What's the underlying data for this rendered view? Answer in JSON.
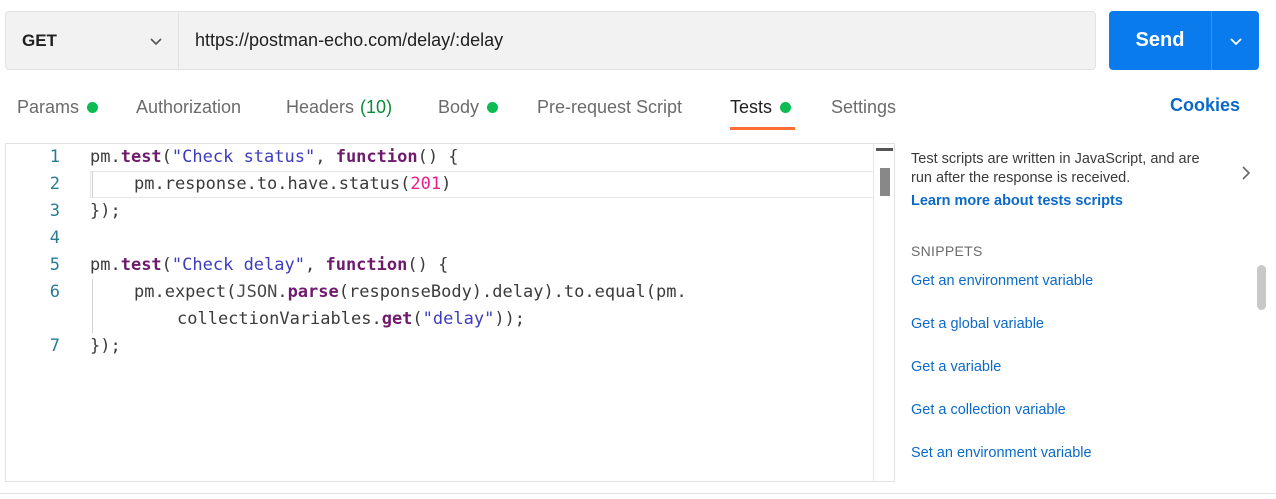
{
  "request": {
    "method": "GET",
    "url": "https://postman-echo.com/delay/:delay",
    "send_label": "Send"
  },
  "tabs": [
    {
      "label": "Params",
      "dot": true
    },
    {
      "label": "Authorization"
    },
    {
      "label": "Headers",
      "count": "(10)"
    },
    {
      "label": "Body",
      "dot": true
    },
    {
      "label": "Pre-request Script"
    },
    {
      "label": "Tests",
      "dot": true,
      "active": true
    },
    {
      "label": "Settings"
    }
  ],
  "cookies_label": "Cookies",
  "editor": {
    "line_numbers": [
      "1",
      "2",
      "3",
      "4",
      "5",
      "6",
      "7"
    ],
    "lines": {
      "l1": {
        "a": "pm.",
        "b": "test",
        "c": "(",
        "d": "\"Check status\"",
        "e": ", ",
        "f": "function",
        "g": "() {"
      },
      "l2": {
        "a": "pm.response.to.have.status(",
        "b": "201",
        "c": ")"
      },
      "l3": "});",
      "l5": {
        "a": "pm.",
        "b": "test",
        "c": "(",
        "d": "\"Check delay\"",
        "e": ", ",
        "f": "function",
        "g": "() {"
      },
      "l6a": {
        "a": "pm.expect(",
        "b": "JSON",
        "c": ".",
        "d": "parse",
        "e": "(responseBody).delay).to.equal(pm."
      },
      "l6b": {
        "a": "collectionVariables.",
        "b": "get",
        "c": "(",
        "d": "\"delay\"",
        "e": "));"
      },
      "l7": "});"
    }
  },
  "help": {
    "text": "Test scripts are written in JavaScript, and are run after the response is received.",
    "link": "Learn more about tests scripts"
  },
  "snippets": {
    "title": "SNIPPETS",
    "items": [
      "Get an environment variable",
      "Get a global variable",
      "Get a variable",
      "Get a collection variable",
      "Set an environment variable"
    ]
  },
  "colors": {
    "send": "#097bed",
    "active_tab_underline": "#ff6c37",
    "status_dot": "#0cbb52",
    "link": "#0b6ac9"
  }
}
